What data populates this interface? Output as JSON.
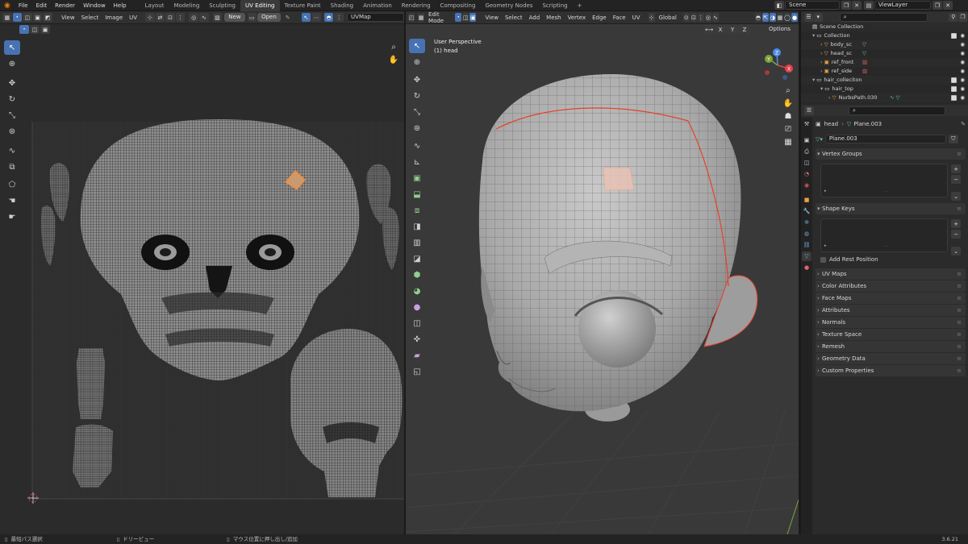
{
  "menu": [
    "File",
    "Edit",
    "Render",
    "Window",
    "Help"
  ],
  "workspaces": [
    "Layout",
    "Modeling",
    "Sculpting",
    "UV Editing",
    "Texture Paint",
    "Shading",
    "Animation",
    "Rendering",
    "Compositing",
    "Geometry Nodes",
    "Scripting"
  ],
  "scene_name": "Scene",
  "view_layer": "ViewLayer",
  "uv_editor": {
    "menus": [
      "View",
      "Select",
      "Image",
      "UV"
    ],
    "new_label": "New",
    "open_label": "Open",
    "uvmap_field": "UVMap"
  },
  "viewport": {
    "mode": "Edit Mode",
    "menus": [
      "View",
      "Select",
      "Add",
      "Mesh",
      "Vertex",
      "Edge",
      "Face",
      "UV"
    ],
    "transform_orientation": "Global",
    "view_name": "User Perspective",
    "object_label": "(1) head",
    "options_label": "Options",
    "xyz": [
      "X",
      "Y",
      "Z"
    ],
    "gizmo_axes": [
      "X",
      "Y",
      "Z"
    ]
  },
  "outliner": {
    "rows": [
      {
        "label": "Scene Collection",
        "indent": 0,
        "type": "scene"
      },
      {
        "label": "Collection",
        "indent": 1,
        "type": "collection",
        "check": true
      },
      {
        "label": "body_sc",
        "indent": 2,
        "type": "object"
      },
      {
        "label": "head_sc",
        "indent": 2,
        "type": "object"
      },
      {
        "label": "ref_front",
        "indent": 2,
        "type": "image"
      },
      {
        "label": "ref_side",
        "indent": 2,
        "type": "image"
      },
      {
        "label": "hair_colleciton",
        "indent": 1,
        "type": "collection",
        "check": true
      },
      {
        "label": "hair_top",
        "indent": 2,
        "type": "collection",
        "check": true
      },
      {
        "label": "NurbsPath.030",
        "indent": 3,
        "type": "curve"
      }
    ]
  },
  "properties": {
    "object_name": "head",
    "mesh_name": "Plane.003",
    "mesh_field": "Plane.003",
    "vertex_groups_label": "Vertex Groups",
    "shape_keys_label": "Shape Keys",
    "add_rest_position_label": "Add Rest Position",
    "panels": [
      "UV Maps",
      "Color Attributes",
      "Face Maps",
      "Attributes",
      "Normals",
      "Texture Space",
      "Remesh",
      "Geometry Data",
      "Custom Properties"
    ]
  },
  "status": {
    "left": "最短パス選択",
    "middle": "ドリービュー",
    "right": "マウス位置に押し出し/追加",
    "version": "3.6.21"
  },
  "colors": {
    "accent": "#4772b3",
    "seam": "#e8402a",
    "selection": "#ff8a2a"
  }
}
